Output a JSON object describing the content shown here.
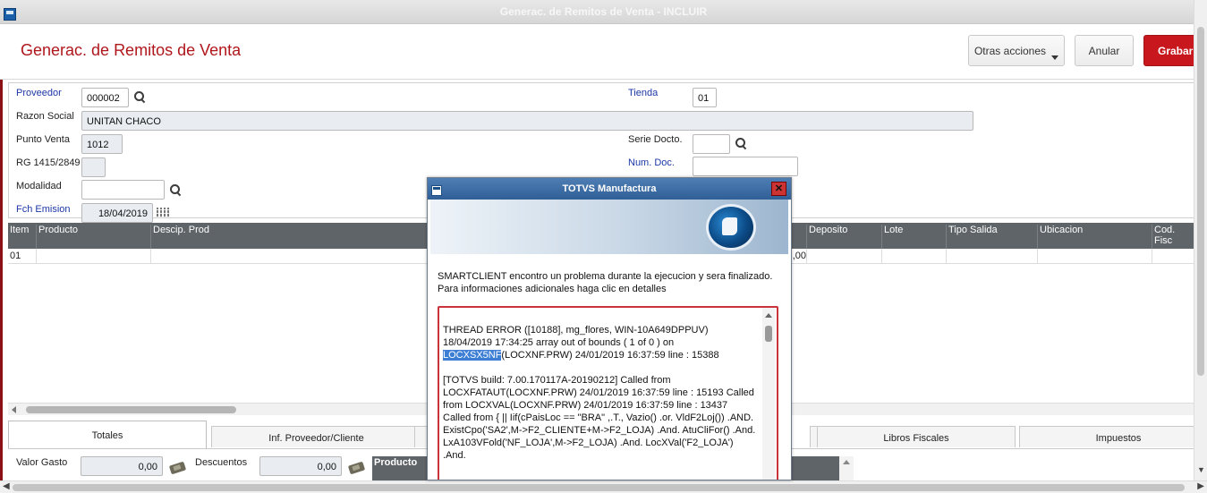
{
  "window": {
    "title": "Generac. de Remitos de Venta - INCLUIR"
  },
  "header": {
    "title": "Generac. de Remitos de Venta",
    "more_actions": "Otras acciones",
    "cancel": "Anular",
    "save": "Grabar"
  },
  "form": {
    "proveedor_label": "Proveedor",
    "proveedor_value": "000002",
    "tienda_label": "Tienda",
    "tienda_value": "01",
    "razon_label": "Razon Social",
    "razon_value": "UNITAN CHACO",
    "punto_label": "Punto Venta",
    "punto_value": "1012",
    "serie_label": "Serie Docto.",
    "serie_value": "",
    "rg_label": "RG 1415/2849",
    "rg_value": "",
    "numdoc_label": "Num. Doc.",
    "numdoc_value": "",
    "modalidad_label": "Modalidad",
    "modalidad_value": "",
    "fecha_label": "Fch Emision",
    "fecha_value": "18/04/2019"
  },
  "grid": {
    "columns": [
      "Item",
      "Producto",
      "Descip. Prod",
      "Deposito",
      "Lote",
      "Tipo Salida",
      "Ubicacion",
      "Cod. Fisc"
    ],
    "row": {
      "item": "01",
      "partial_value": ",00"
    }
  },
  "tabs": [
    "Totales",
    "Inf. Proveedor/Cliente",
    "Libros Fiscales",
    "Impuestos"
  ],
  "totales": {
    "valor_gasto_label": "Valor Gasto",
    "valor_gasto_value": "0,00",
    "descuentos_label": "Descuentos",
    "descuentos_value": "0,00",
    "producto_header": "Producto"
  },
  "dialog": {
    "title": "TOTVS Manufactura",
    "message_line1": "SMARTCLIENT encontro un problema durante la ejecucion y sera finalizado.",
    "message_line2": "Para informaciones adicionales haga clic en detalles",
    "error_pre": "THREAD ERROR ([10188], mg_flores, WIN-10A649DPPUV)   18/04/2019 17:34:25 array out of bounds ( 1 of 0 )  on ",
    "error_highlight": "LOCXSX5NF",
    "error_post": "(LOCXNF.PRW) 24/01/2019 16:37:59 line : 15388",
    "trace": "[TOTVS build: 7.00.170117A-20190212] Called from LOCXFATAUT(LOCXNF.PRW) 24/01/2019 16:37:59 line : 15193 Called from LOCXVAL(LOCXNF.PRW) 24/01/2019 16:37:59 line : 13437 Called from { || Iif(cPaisLoc == \"BRA\" ,.T.,  Vazio() .or. VldF2Loj()) .AND. ExistCpo('SA2',M->F2_CLIENTE+M->F2_LOJA) .And. AtuCliFor() .And. LxA103VFold('NF_LOJA',M->F2_LOJA) .And. LocXVal('F2_LOJA') .And."
  }
}
